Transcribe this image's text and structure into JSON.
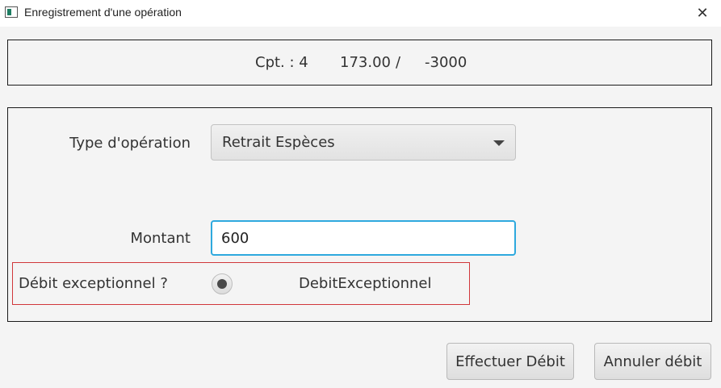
{
  "window": {
    "title": "Enregistrement d'une opération",
    "close_glyph": "✕"
  },
  "account": {
    "number": "Cpt. : 4",
    "balance": "173.00",
    "separator": "/",
    "overdraft_limit": "-3000"
  },
  "form": {
    "type_label": "Type d'opération",
    "type_value": "Retrait Espèces",
    "amount_label": "Montant",
    "amount_value": "600",
    "exceptional_label": "Débit exceptionnel ?",
    "exceptional_option": "DebitExceptionnel",
    "exceptional_selected": true
  },
  "buttons": {
    "confirm": "Effectuer Débit",
    "cancel": "Annuler débit"
  },
  "colors": {
    "focus_border": "#2ea9de",
    "highlight_border": "#d0373a",
    "icon_accent": "#1e7d62"
  }
}
